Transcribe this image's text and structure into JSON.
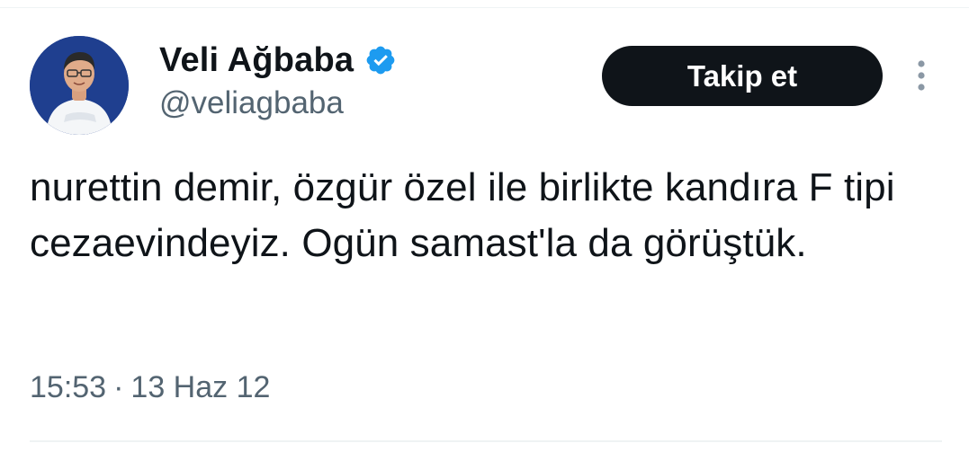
{
  "tweet": {
    "author": {
      "display_name": "Veli Ağbaba",
      "handle": "@veliagbaba",
      "verified": true,
      "verified_icon": "verified-badge-icon",
      "verified_color": "#1d9bf0"
    },
    "follow_label": "Takip et",
    "more_icon": "more-vertical-icon",
    "text": "nurettin demir, özgür özel ile birlikte kandıra F tipi cezaevindeyiz. Ogün samast'la da görüştük.",
    "time": "15:53",
    "separator": "·",
    "date": "13 Haz 12"
  }
}
